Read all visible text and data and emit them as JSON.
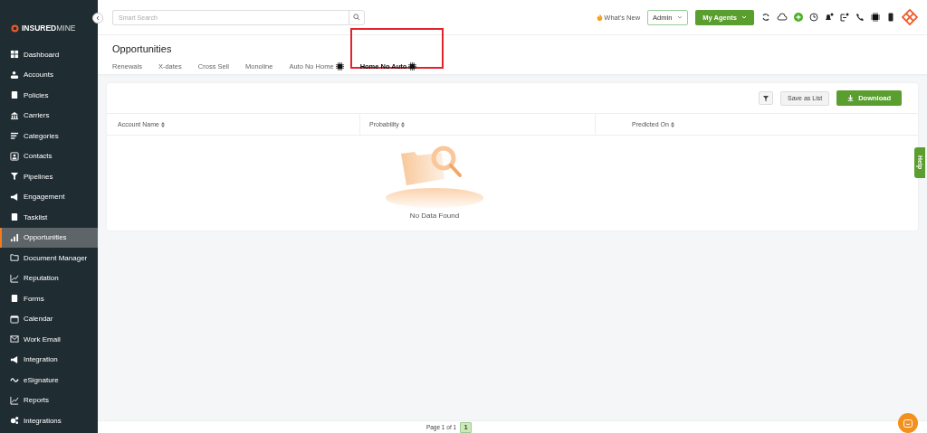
{
  "sidebar": {
    "logo": {
      "bold": "INSURED",
      "light": "MINE"
    },
    "items": [
      {
        "label": "Dashboard",
        "selected": false
      },
      {
        "label": "Accounts",
        "selected": false
      },
      {
        "label": "Policies",
        "selected": false
      },
      {
        "label": "Carriers",
        "selected": false
      },
      {
        "label": "Categories",
        "selected": false
      },
      {
        "label": "Contacts",
        "selected": false
      },
      {
        "label": "Pipelines",
        "selected": false
      },
      {
        "label": "Engagement",
        "selected": false
      },
      {
        "label": "Tasklist",
        "selected": false
      },
      {
        "label": "Opportunities",
        "selected": true
      },
      {
        "label": "Document Manager",
        "selected": false
      },
      {
        "label": "Reputation",
        "selected": false
      },
      {
        "label": "Forms",
        "selected": false
      },
      {
        "label": "Calendar",
        "selected": false
      },
      {
        "label": "Work Email",
        "selected": false
      },
      {
        "label": "Integration",
        "selected": false
      },
      {
        "label": "eSignature",
        "selected": false
      },
      {
        "label": "Reports",
        "selected": false
      },
      {
        "label": "Integrations",
        "selected": false
      }
    ]
  },
  "topbar": {
    "search": {
      "placeholder": "Smart Search"
    },
    "whats_new": "What's New",
    "role_select": "Admin",
    "agents_button": "My Agents"
  },
  "page": {
    "title": "Opportunities",
    "tabs": [
      {
        "label": "Renewals",
        "selected": false,
        "ai": false,
        "highlighted": false
      },
      {
        "label": "X-dates",
        "selected": false,
        "ai": false,
        "highlighted": false
      },
      {
        "label": "Cross Sell",
        "selected": false,
        "ai": false,
        "highlighted": false
      },
      {
        "label": "Monoline",
        "selected": false,
        "ai": false,
        "highlighted": false
      },
      {
        "label": "Auto No Home",
        "selected": false,
        "ai": true,
        "highlighted": false
      },
      {
        "label": "Home No Auto",
        "selected": true,
        "ai": true,
        "highlighted": true
      }
    ]
  },
  "toolbar": {
    "save_button": "Save as List",
    "download_button": "Download"
  },
  "table": {
    "columns": [
      "Account Name",
      "Probability",
      "Predicted On"
    ],
    "empty_message": "No Data Found"
  },
  "help_tab": "Help",
  "pagination": {
    "label": "Page 1 of 1",
    "pages": [
      {
        "label": "1",
        "selected": true
      }
    ]
  }
}
